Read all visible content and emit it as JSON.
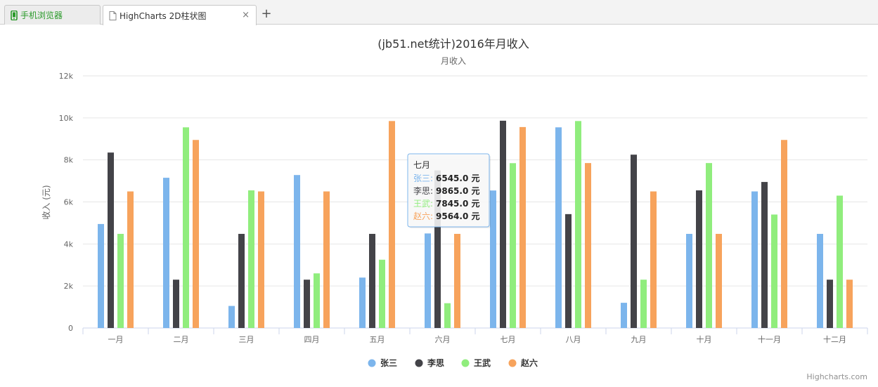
{
  "tabs": [
    {
      "label": "手机浏览器",
      "icon": "phone-icon",
      "active": false,
      "color": "#2a9a2a"
    },
    {
      "label": "HighCharts 2D柱状图",
      "icon": "document-icon",
      "active": true
    }
  ],
  "new_tab_label": "+",
  "close_label": "×",
  "credits": "Highcharts.com",
  "tooltip": {
    "title": "七月",
    "rows": [
      {
        "name": "张三",
        "value": "6545.0 元"
      },
      {
        "name": "李思",
        "value": "9865.0 元"
      },
      {
        "name": "王武",
        "value": "7845.0 元"
      },
      {
        "name": "赵六",
        "value": "9564.0 元"
      }
    ]
  },
  "chart_data": {
    "type": "bar",
    "title": "(jb51.net统计)2016年月收入",
    "subtitle": "月收入",
    "xlabel": "",
    "ylabel": "收入 (元)",
    "ylim": [
      0,
      12000
    ],
    "yticks": [
      0,
      2000,
      4000,
      6000,
      8000,
      10000,
      12000
    ],
    "ytick_labels": [
      "0",
      "2k",
      "4k",
      "6k",
      "8k",
      "10k",
      "12k"
    ],
    "grid": true,
    "legend": "bottom-center",
    "categories": [
      "一月",
      "二月",
      "三月",
      "四月",
      "五月",
      "六月",
      "七月",
      "八月",
      "九月",
      "十月",
      "十一月",
      "十二月"
    ],
    "series": [
      {
        "name": "张三",
        "color": "#7cb5ec",
        "values": [
          4950,
          7150,
          1050,
          7280,
          2400,
          4500,
          6545,
          9550,
          1200,
          4480,
          6500,
          4480
        ]
      },
      {
        "name": "李思",
        "color": "#434348",
        "values": [
          8350,
          2300,
          4480,
          2300,
          4480,
          7500,
          9865,
          5420,
          8250,
          6550,
          6950,
          2300
        ]
      },
      {
        "name": "王武",
        "color": "#90ed7d",
        "values": [
          4480,
          9550,
          6550,
          2600,
          3250,
          1180,
          7845,
          9850,
          2300,
          7850,
          5400,
          6300
        ]
      },
      {
        "name": "赵六",
        "color": "#f7a35c",
        "values": [
          6500,
          8950,
          6500,
          6500,
          9850,
          4480,
          9564,
          7850,
          6500,
          4480,
          8950,
          2300
        ]
      }
    ]
  }
}
